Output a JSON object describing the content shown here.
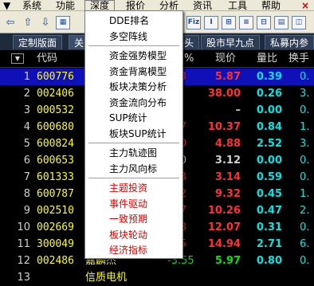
{
  "menubar": {
    "items": [
      "系统",
      "功能",
      "报价",
      "分析",
      "资讯",
      "工具",
      "帮助"
    ],
    "active": "深度",
    "close": "×"
  },
  "toolbar": {
    "buttons": [
      "⇦",
      "⇧",
      "⇩",
      "▦",
      "日",
      "周",
      "Fiz",
      "Ⅰ",
      "⊞",
      "≡",
      "⊟",
      "▤",
      "◫",
      "▥",
      "✕"
    ]
  },
  "tabs": [
    "定制版面",
    "关",
    "头",
    "股市早九点",
    "私募内参"
  ],
  "header": {
    "sort": "▼",
    "code": "代码",
    "pct": "%",
    "price": "现价",
    "ratio": "量比",
    "turnover": "换手"
  },
  "rows": [
    {
      "num": "1",
      "code": "600776",
      "name": "",
      "pct": "33",
      "price": "5.87",
      "ratio": "0.39",
      "turn": "0.",
      "price_color": "#ff3030",
      "pct_color": "#ff3030",
      "selected": true
    },
    {
      "num": "2",
      "code": "002406",
      "name": "",
      "pct": "",
      "price": "38.00",
      "ratio": "0.26",
      "turn": "3.",
      "price_color": "#ff3030",
      "pct_color": "#ff3030",
      "selected": false
    },
    {
      "num": "3",
      "code": "000532",
      "name": "",
      "pct": "",
      "price": "–",
      "ratio": "0.00",
      "turn": "0.",
      "price_color": "#d0d0d0",
      "pct_color": "#d0d0d0",
      "selected": false
    },
    {
      "num": "4",
      "code": "600680",
      "name": "",
      "pct": "67",
      "price": "10.37",
      "ratio": "0.84",
      "turn": "1.",
      "price_color": "#ff3030",
      "pct_color": "#ff3030",
      "selected": false
    },
    {
      "num": "5",
      "code": "600824",
      "name": "",
      "pct": "40",
      "price": "4.88",
      "ratio": "2.52",
      "turn": "3.",
      "price_color": "#ff3030",
      "pct_color": "#ff3030",
      "selected": false
    },
    {
      "num": "6",
      "code": "600653",
      "name": "",
      "pct": "00",
      "price": "3.12",
      "ratio": "0.00",
      "turn": "0.",
      "price_color": "#d0d0d0",
      "pct_color": "#d0d0d0",
      "selected": false
    },
    {
      "num": "7",
      "code": "601333",
      "name": "",
      "pct": "63",
      "price": "3.14",
      "ratio": "0.59",
      "turn": "0.",
      "price_color": "#ff3030",
      "pct_color": "#ff3030",
      "selected": false
    },
    {
      "num": "8",
      "code": "600787",
      "name": "",
      "pct": "22",
      "price": "9.32",
      "ratio": "0.45",
      "turn": "1.",
      "price_color": "#ff3030",
      "pct_color": "#ff3030",
      "selected": false
    },
    {
      "num": "9",
      "code": "002510",
      "name": "",
      "pct": "07",
      "price": "10.26",
      "ratio": "0.47",
      "turn": "2.",
      "price_color": "#ff3030",
      "pct_color": "#ff3030",
      "selected": false
    },
    {
      "num": "10",
      "code": "002669",
      "name": "",
      "pct": "33",
      "price": "12.07",
      "ratio": "0.31",
      "turn": "0.",
      "price_color": "#ff3030",
      "pct_color": "#ff3030",
      "selected": false
    },
    {
      "num": "11",
      "code": "300049",
      "name": "",
      "pct": "35",
      "price": "14.94",
      "ratio": "2.71",
      "turn": "6.",
      "price_color": "#ff3030",
      "pct_color": "#ff3030",
      "selected": false
    },
    {
      "num": "12",
      "code": "002486",
      "name": "嘉麟杰",
      "pct": "-3.55",
      "price": "5.97",
      "ratio": "0.80",
      "turn": "0.",
      "price_color": "#00e600",
      "pct_color": "#00e600",
      "selected": false
    },
    {
      "num": "13",
      "code": "",
      "name": "信质电机",
      "pct": "",
      "price": "",
      "ratio": "",
      "turn": "",
      "price_color": "#ff3030",
      "pct_color": "#ff3030",
      "selected": false
    }
  ],
  "dropdown": {
    "items": [
      {
        "label": "DDE排名",
        "red": false
      },
      {
        "label": "多空阵线",
        "red": false
      },
      {
        "sep": true
      },
      {
        "label": "资金强势模型",
        "red": false
      },
      {
        "label": "资金背离模型",
        "red": false
      },
      {
        "label": "板块决策分析",
        "red": false
      },
      {
        "label": "资金流向分布",
        "red": false
      },
      {
        "label": "SUP统计",
        "red": false
      },
      {
        "label": "板块SUP统计",
        "red": false
      },
      {
        "sep": true
      },
      {
        "label": "主力轨迹图",
        "red": false
      },
      {
        "label": "主力风向标",
        "red": false
      },
      {
        "sep": true
      },
      {
        "label": "主题投资",
        "red": true
      },
      {
        "label": "事件驱动",
        "red": true
      },
      {
        "label": "一致预期",
        "red": true
      },
      {
        "label": "板块轮动",
        "red": true
      },
      {
        "label": "经济指标",
        "red": true
      }
    ]
  }
}
